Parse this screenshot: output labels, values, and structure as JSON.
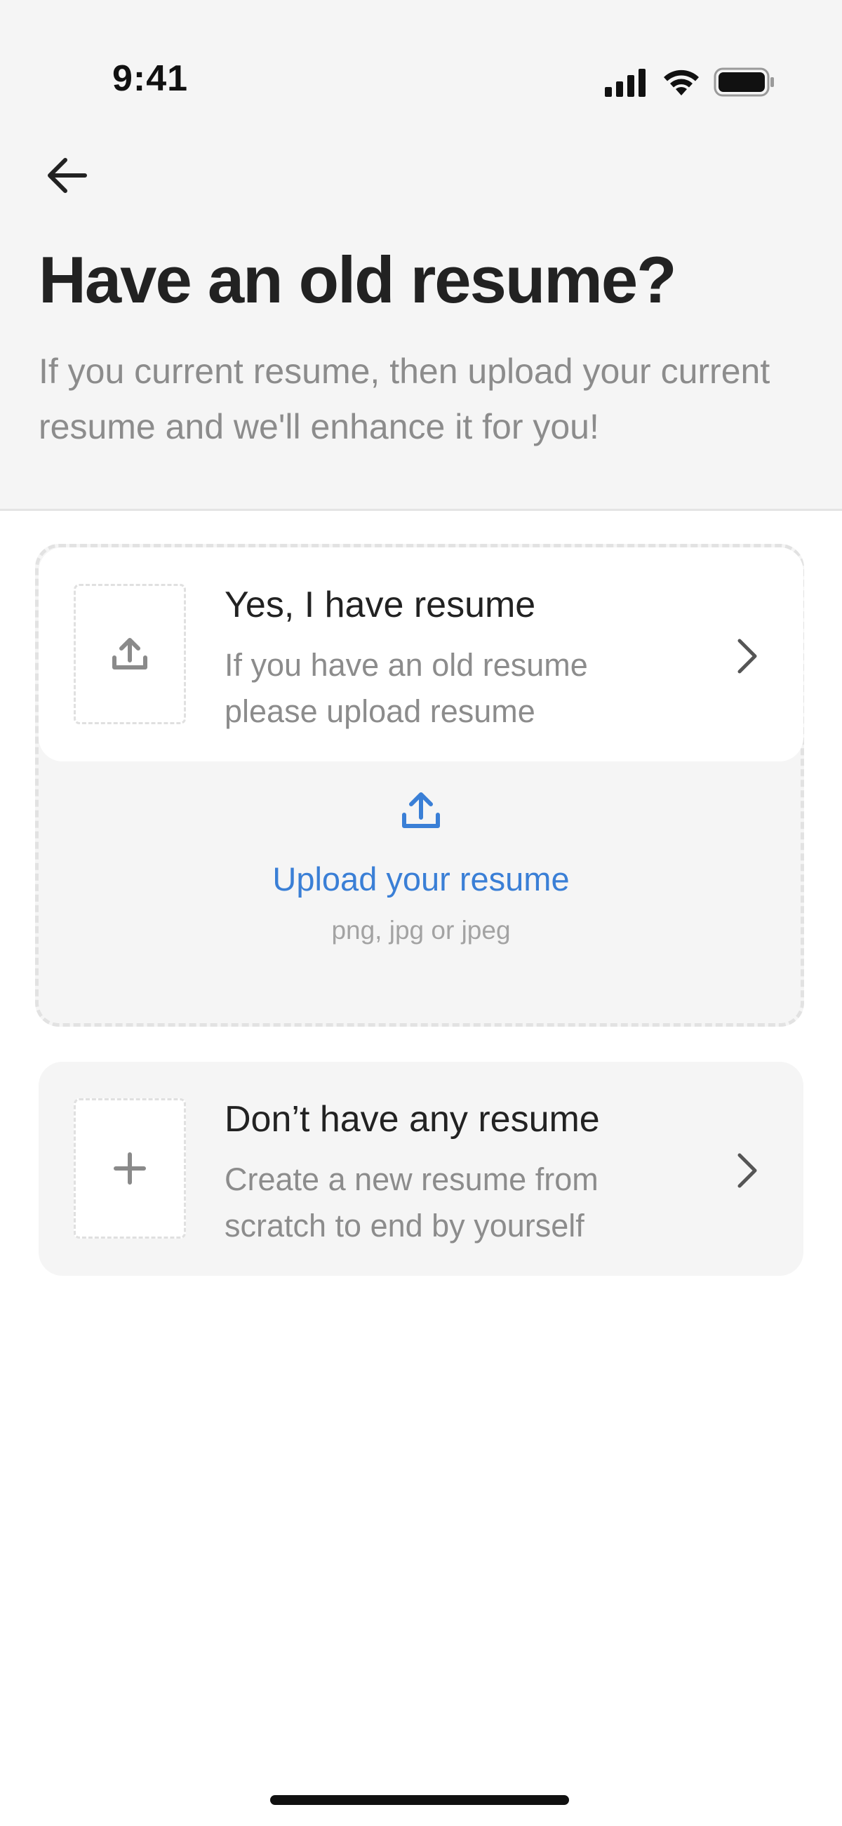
{
  "status_bar": {
    "time": "9:41",
    "icons": [
      "signal-icon",
      "wifi-icon",
      "battery-icon"
    ]
  },
  "header": {
    "back_icon": "arrow-left-icon",
    "title": "Have an old resume?",
    "subtitle": "If you current resume, then upload your current resume and we'll enhance it for you!"
  },
  "options": {
    "has_resume": {
      "title": "Yes, I have resume",
      "description": "If you have an old resume please upload resume",
      "icon": "upload-icon"
    },
    "no_resume": {
      "title": "Don’t have any resume",
      "description": "Create a new resume from scratch to end by yourself",
      "icon": "plus-icon"
    }
  },
  "upload": {
    "label": "Upload your resume",
    "hint": "png, jpg or jpeg",
    "icon": "upload-icon"
  },
  "colors": {
    "accent": "#3a7fd6",
    "header_bg": "#f5f5f5",
    "text_primary": "#222222",
    "text_secondary": "#8c8c8c"
  }
}
